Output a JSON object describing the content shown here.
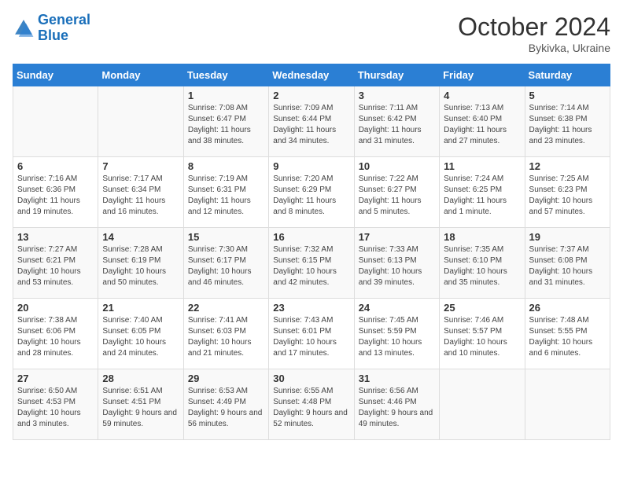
{
  "logo": {
    "line1": "General",
    "line2": "Blue"
  },
  "title": "October 2024",
  "subtitle": "Bykivka, Ukraine",
  "days_header": [
    "Sunday",
    "Monday",
    "Tuesday",
    "Wednesday",
    "Thursday",
    "Friday",
    "Saturday"
  ],
  "weeks": [
    [
      {
        "day": "",
        "info": ""
      },
      {
        "day": "",
        "info": ""
      },
      {
        "day": "1",
        "info": "Sunrise: 7:08 AM\nSunset: 6:47 PM\nDaylight: 11 hours and 38 minutes."
      },
      {
        "day": "2",
        "info": "Sunrise: 7:09 AM\nSunset: 6:44 PM\nDaylight: 11 hours and 34 minutes."
      },
      {
        "day": "3",
        "info": "Sunrise: 7:11 AM\nSunset: 6:42 PM\nDaylight: 11 hours and 31 minutes."
      },
      {
        "day": "4",
        "info": "Sunrise: 7:13 AM\nSunset: 6:40 PM\nDaylight: 11 hours and 27 minutes."
      },
      {
        "day": "5",
        "info": "Sunrise: 7:14 AM\nSunset: 6:38 PM\nDaylight: 11 hours and 23 minutes."
      }
    ],
    [
      {
        "day": "6",
        "info": "Sunrise: 7:16 AM\nSunset: 6:36 PM\nDaylight: 11 hours and 19 minutes."
      },
      {
        "day": "7",
        "info": "Sunrise: 7:17 AM\nSunset: 6:34 PM\nDaylight: 11 hours and 16 minutes."
      },
      {
        "day": "8",
        "info": "Sunrise: 7:19 AM\nSunset: 6:31 PM\nDaylight: 11 hours and 12 minutes."
      },
      {
        "day": "9",
        "info": "Sunrise: 7:20 AM\nSunset: 6:29 PM\nDaylight: 11 hours and 8 minutes."
      },
      {
        "day": "10",
        "info": "Sunrise: 7:22 AM\nSunset: 6:27 PM\nDaylight: 11 hours and 5 minutes."
      },
      {
        "day": "11",
        "info": "Sunrise: 7:24 AM\nSunset: 6:25 PM\nDaylight: 11 hours and 1 minute."
      },
      {
        "day": "12",
        "info": "Sunrise: 7:25 AM\nSunset: 6:23 PM\nDaylight: 10 hours and 57 minutes."
      }
    ],
    [
      {
        "day": "13",
        "info": "Sunrise: 7:27 AM\nSunset: 6:21 PM\nDaylight: 10 hours and 53 minutes."
      },
      {
        "day": "14",
        "info": "Sunrise: 7:28 AM\nSunset: 6:19 PM\nDaylight: 10 hours and 50 minutes."
      },
      {
        "day": "15",
        "info": "Sunrise: 7:30 AM\nSunset: 6:17 PM\nDaylight: 10 hours and 46 minutes."
      },
      {
        "day": "16",
        "info": "Sunrise: 7:32 AM\nSunset: 6:15 PM\nDaylight: 10 hours and 42 minutes."
      },
      {
        "day": "17",
        "info": "Sunrise: 7:33 AM\nSunset: 6:13 PM\nDaylight: 10 hours and 39 minutes."
      },
      {
        "day": "18",
        "info": "Sunrise: 7:35 AM\nSunset: 6:10 PM\nDaylight: 10 hours and 35 minutes."
      },
      {
        "day": "19",
        "info": "Sunrise: 7:37 AM\nSunset: 6:08 PM\nDaylight: 10 hours and 31 minutes."
      }
    ],
    [
      {
        "day": "20",
        "info": "Sunrise: 7:38 AM\nSunset: 6:06 PM\nDaylight: 10 hours and 28 minutes."
      },
      {
        "day": "21",
        "info": "Sunrise: 7:40 AM\nSunset: 6:05 PM\nDaylight: 10 hours and 24 minutes."
      },
      {
        "day": "22",
        "info": "Sunrise: 7:41 AM\nSunset: 6:03 PM\nDaylight: 10 hours and 21 minutes."
      },
      {
        "day": "23",
        "info": "Sunrise: 7:43 AM\nSunset: 6:01 PM\nDaylight: 10 hours and 17 minutes."
      },
      {
        "day": "24",
        "info": "Sunrise: 7:45 AM\nSunset: 5:59 PM\nDaylight: 10 hours and 13 minutes."
      },
      {
        "day": "25",
        "info": "Sunrise: 7:46 AM\nSunset: 5:57 PM\nDaylight: 10 hours and 10 minutes."
      },
      {
        "day": "26",
        "info": "Sunrise: 7:48 AM\nSunset: 5:55 PM\nDaylight: 10 hours and 6 minutes."
      }
    ],
    [
      {
        "day": "27",
        "info": "Sunrise: 6:50 AM\nSunset: 4:53 PM\nDaylight: 10 hours and 3 minutes."
      },
      {
        "day": "28",
        "info": "Sunrise: 6:51 AM\nSunset: 4:51 PM\nDaylight: 9 hours and 59 minutes."
      },
      {
        "day": "29",
        "info": "Sunrise: 6:53 AM\nSunset: 4:49 PM\nDaylight: 9 hours and 56 minutes."
      },
      {
        "day": "30",
        "info": "Sunrise: 6:55 AM\nSunset: 4:48 PM\nDaylight: 9 hours and 52 minutes."
      },
      {
        "day": "31",
        "info": "Sunrise: 6:56 AM\nSunset: 4:46 PM\nDaylight: 9 hours and 49 minutes."
      },
      {
        "day": "",
        "info": ""
      },
      {
        "day": "",
        "info": ""
      }
    ]
  ]
}
